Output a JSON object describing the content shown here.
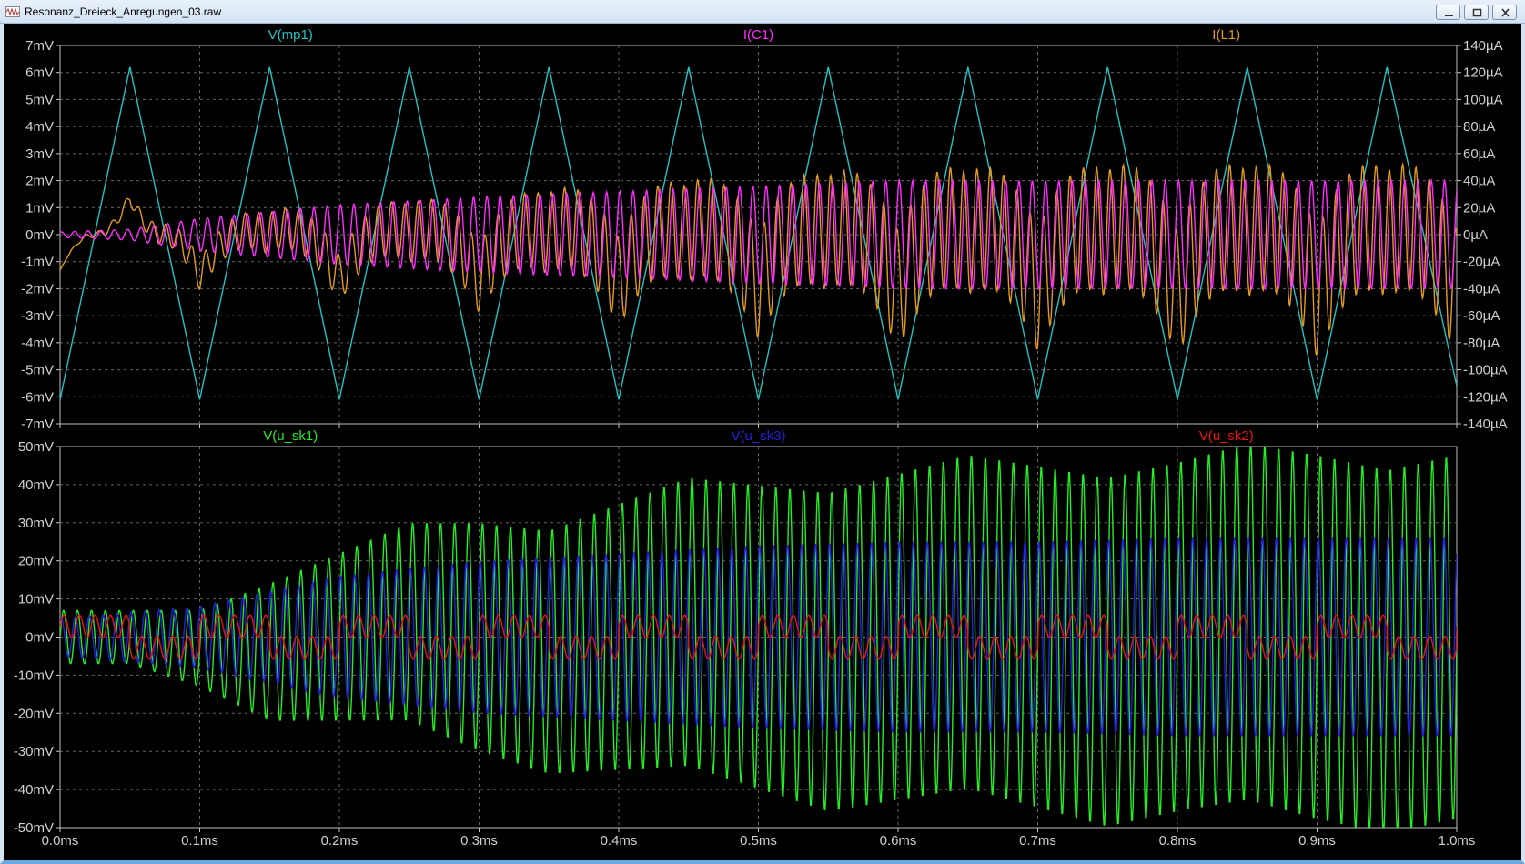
{
  "window": {
    "title": "Resonanz_Dreieck_Anregungen_03.raw",
    "icon": "waveform-icon",
    "controls": [
      "minimize-icon",
      "restore-icon",
      "close-icon"
    ]
  },
  "colors": {
    "background": "#000000",
    "axis": "#c0c0c0",
    "grid": "#666666",
    "mp1": "#22c2c2",
    "c1": "#ff2cff",
    "l1": "#e39a1c",
    "sk1": "#22ee22",
    "sk3": "#2222dd",
    "sk2": "#ee1111"
  },
  "chart_data": [
    {
      "type": "line",
      "title": "",
      "x_range": [
        0.0,
        1.0
      ],
      "x_unit": "ms",
      "x_ticks": [
        "0.0ms",
        "0.1ms",
        "0.2ms",
        "0.3ms",
        "0.4ms",
        "0.5ms",
        "0.6ms",
        "0.7ms",
        "0.8ms",
        "0.9ms",
        "1.0ms"
      ],
      "y_left": {
        "range": [
          -7,
          7
        ],
        "unit": "mV",
        "ticks": [
          "7mV",
          "6mV",
          "5mV",
          "4mV",
          "3mV",
          "2mV",
          "1mV",
          "0mV",
          "-1mV",
          "-2mV",
          "-3mV",
          "-4mV",
          "-5mV",
          "-6mV",
          "-7mV"
        ]
      },
      "y_right": {
        "range": [
          -140,
          140
        ],
        "unit": "µA",
        "ticks": [
          "140µA",
          "120µA",
          "100µA",
          "80µA",
          "60µA",
          "40µA",
          "20µA",
          "0µA",
          "-20µA",
          "-40µA",
          "-60µA",
          "-80µA",
          "-100µA",
          "-120µA",
          "-140µA"
        ]
      },
      "grid": true,
      "series": [
        {
          "name": "V(mp1)",
          "axis": "left",
          "color": "#22c2c2",
          "x": [
            0.0,
            0.05,
            0.1,
            0.15,
            0.2,
            0.25,
            0.3,
            0.35,
            0.4,
            0.45,
            0.5,
            0.55,
            0.6,
            0.65,
            0.7,
            0.75,
            0.8,
            0.85,
            0.9,
            0.95,
            1.0
          ],
          "y": [
            -6.1,
            6.2,
            -6.1,
            6.2,
            -6.1,
            6.2,
            -6.1,
            6.2,
            -6.1,
            6.2,
            -6.1,
            6.2,
            -6.1,
            6.2,
            -6.1,
            6.2,
            -6.1,
            6.2,
            -6.1,
            6.2,
            -5.6
          ]
        },
        {
          "name": "I(C1)",
          "axis": "right",
          "color": "#ff2cff",
          "carrier_cycles_per_ms": 105,
          "x": [
            0.0,
            0.05,
            0.1,
            0.2,
            0.3,
            0.4,
            0.5,
            0.6,
            0.7,
            0.8,
            0.9,
            1.0
          ],
          "envelope": [
            2,
            4,
            12,
            22,
            28,
            32,
            36,
            40,
            40,
            40,
            40,
            40
          ]
        },
        {
          "name": "I(L1)",
          "axis": "right",
          "color": "#e39a1c",
          "carrier_cycles_per_ms": 105,
          "x": [
            0.0,
            0.05,
            0.1,
            0.2,
            0.3,
            0.4,
            0.5,
            0.6,
            0.7,
            0.8,
            0.9,
            1.0
          ],
          "envelope": [
            0,
            8,
            20,
            32,
            45,
            60,
            70,
            80,
            82,
            84,
            85,
            85
          ],
          "drive_component": [
            -48,
            50,
            -55,
            60,
            -60,
            65,
            -70,
            75,
            -75,
            80,
            -80,
            80
          ]
        }
      ]
    },
    {
      "type": "line",
      "title": "",
      "x_range": [
        0.0,
        1.0
      ],
      "x_unit": "ms",
      "x_ticks": [
        "0.0ms",
        "0.1ms",
        "0.2ms",
        "0.3ms",
        "0.4ms",
        "0.5ms",
        "0.6ms",
        "0.7ms",
        "0.8ms",
        "0.9ms",
        "1.0ms"
      ],
      "y_left": {
        "range": [
          -50,
          50
        ],
        "unit": "mV",
        "ticks": [
          "50mV",
          "40mV",
          "30mV",
          "20mV",
          "10mV",
          "0mV",
          "-10mV",
          "-20mV",
          "-30mV",
          "-40mV",
          "-50mV"
        ]
      },
      "grid": true,
      "series": [
        {
          "name": "V(u_sk1)",
          "color": "#22ee22",
          "carrier_cycles_per_ms": 100,
          "x": [
            0.0,
            0.05,
            0.1,
            0.15,
            0.2,
            0.25,
            0.3,
            0.35,
            0.4,
            0.45,
            0.5,
            0.55,
            0.6,
            0.65,
            0.7,
            0.75,
            0.8,
            0.85,
            0.9,
            0.95,
            1.0
          ],
          "envelope": [
            7,
            7,
            10,
            18,
            22,
            26,
            30,
            32,
            35,
            38,
            40,
            42,
            43,
            44,
            45,
            46,
            46,
            47,
            48,
            48,
            48
          ],
          "offset": [
            0,
            0,
            -3,
            -4,
            0,
            4,
            0,
            -4,
            0,
            4,
            0,
            -4,
            0,
            4,
            0,
            -4,
            0,
            4,
            0,
            -4,
            0
          ]
        },
        {
          "name": "V(u_sk3)",
          "color": "#2222dd",
          "carrier_cycles_per_ms": 100,
          "x": [
            0.0,
            0.1,
            0.2,
            0.3,
            0.4,
            0.5,
            0.6,
            0.7,
            0.8,
            0.9,
            1.0
          ],
          "envelope": [
            5,
            8,
            16,
            20,
            22,
            24,
            25,
            25,
            26,
            26,
            26
          ]
        },
        {
          "name": "V(u_sk2)",
          "color": "#ee1111",
          "carrier_cycles_per_ms": 90,
          "x": [
            0.0,
            0.05,
            0.1,
            0.2,
            0.3,
            0.4,
            0.5,
            0.6,
            0.7,
            0.8,
            0.9,
            1.0
          ],
          "envelope": [
            5,
            5,
            5,
            5,
            5,
            5,
            5,
            5,
            5,
            5,
            5,
            5
          ],
          "offset_amplitude": 4
        }
      ]
    }
  ]
}
